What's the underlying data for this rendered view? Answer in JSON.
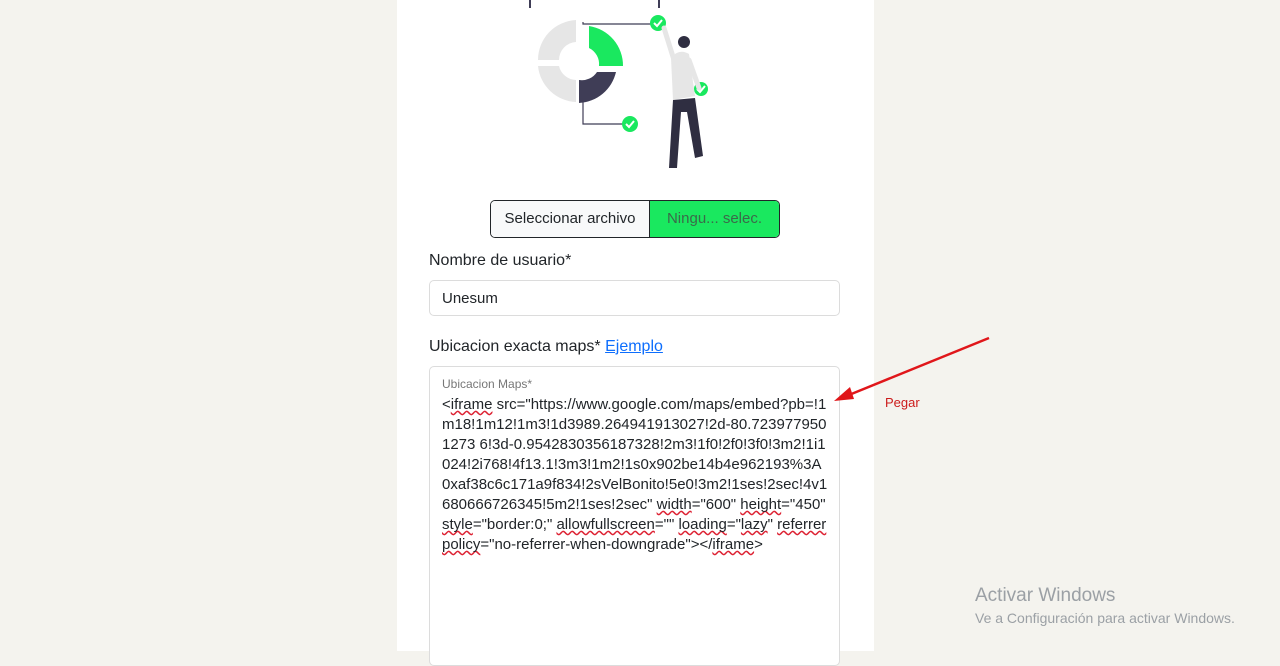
{
  "upload": {
    "button_label": "Seleccionar archivo",
    "status_label": "Ningu... selec."
  },
  "username": {
    "label": "Nombre de usuario*",
    "value": "Unesum"
  },
  "maps": {
    "label": "Ubicacion exacta maps*",
    "example_link": "Ejemplo",
    "floating_label": "Ubicacion Maps*",
    "value_parts": [
      "<",
      "iframe",
      " src=\"https://www.google.com/maps/embed?pb=!1m18!1m12!1m3!1d3989.264941913027!2d-80.7239779501273 6!3d-0.9542830356187328!2m3!1f0!2f0!3f0!3m2!1i1024!2i768!4f13.1!3m3!1m2!1s0x902be14b4e962193%3A0xaf38c6c171a9f834!2sVelBonito!5e0!3m2!1ses!2sec!4v1680666726345!5m2!1ses!2sec\" ",
      "width",
      "=\"600\" ",
      "height",
      "=\"450\" ",
      "style",
      "=\"border:0;\" ",
      "allowfullscreen",
      "=\"\" ",
      "loading",
      "=\"",
      "lazy",
      "\" ",
      "referrerpolicy",
      "=\"no-referrer-when-downgrade\"></",
      "iframe",
      ">"
    ]
  },
  "annotation": {
    "label": "Pegar",
    "color": "#e0161a"
  },
  "watermark": {
    "title": "Activar Windows",
    "subtitle": "Ve a Configuración para activar Windows."
  },
  "colors": {
    "accent_green": "#1ae85f",
    "dark": "#3f3d56",
    "background": "#f4f3ee"
  }
}
